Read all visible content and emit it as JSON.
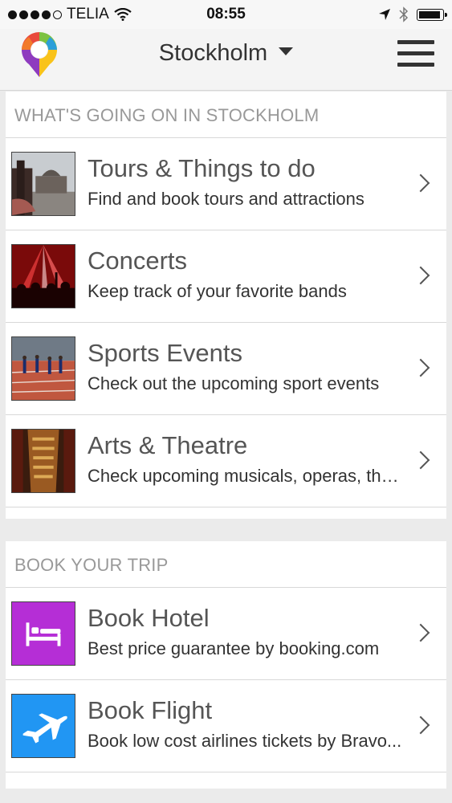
{
  "status_bar": {
    "carrier": "TELIA",
    "time": "08:55"
  },
  "header": {
    "city": "Stockholm"
  },
  "sections": [
    {
      "title": "WHAT'S GOING ON IN STOCKHOLM",
      "items": [
        {
          "title": "Tours & Things to do",
          "subtitle": "Find and book tours and attractions",
          "icon": "tours-photo"
        },
        {
          "title": "Concerts",
          "subtitle": "Keep track of your favorite bands",
          "icon": "concert-photo"
        },
        {
          "title": "Sports Events",
          "subtitle": "Check out the upcoming sport events",
          "icon": "sports-photo"
        },
        {
          "title": "Arts & Theatre",
          "subtitle": "Check upcoming musicals, operas, the...",
          "icon": "theatre-photo"
        }
      ]
    },
    {
      "title": "BOOK YOUR TRIP",
      "items": [
        {
          "title": "Book Hotel",
          "subtitle": "Best price guarantee by booking.com",
          "icon": "bed-icon"
        },
        {
          "title": "Book Flight",
          "subtitle": "Book low cost airlines tickets by Bravo...",
          "icon": "airplane-icon"
        }
      ]
    }
  ],
  "colors": {
    "hotel_tile": "#b52ed6",
    "flight_tile": "#2196f3",
    "section_title": "#999999"
  }
}
